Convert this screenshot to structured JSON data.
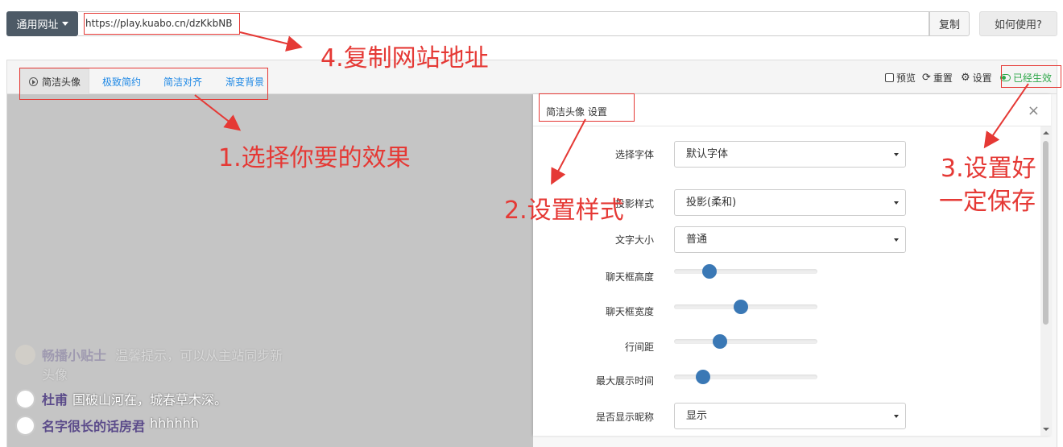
{
  "urlbar": {
    "dropdown_label": "通用网址",
    "url_value": "https://play.kuabo.cn/dzKkbNB",
    "copy_label": "复制",
    "help_label": "如何使用?"
  },
  "tabs": [
    {
      "label": "简洁头像"
    },
    {
      "label": "极致简约"
    },
    {
      "label": "简洁对齐"
    },
    {
      "label": "渐变背景"
    }
  ],
  "toolbar": {
    "preview_label": "预览",
    "reset_label": "重置",
    "settings_label": "设置",
    "status_label": "已经生效"
  },
  "chat": [
    {
      "nick": "畅播小贴士",
      "message": "温馨提示，可以从主站同步新",
      "message_cont": "头像"
    },
    {
      "nick": "杜甫",
      "message": "国破山河在，城春草木深。"
    },
    {
      "nick": "名字很长的话房君",
      "message": "hhhhhh"
    }
  ],
  "settings": {
    "title": "简洁头像 设置",
    "close": "×",
    "font_label": "选择字体",
    "font_value": "默认字体",
    "shadow_label": "投影样式",
    "shadow_value": "投影(柔和)",
    "size_label": "文字大小",
    "size_value": "普通",
    "height_label": "聊天框高度",
    "height_level": 0.22,
    "width_label": "聊天框宽度",
    "width_level": 0.46,
    "spacing_label": "行间距",
    "spacing_level": 0.3,
    "duration_label": "最大展示时间",
    "duration_level": 0.17,
    "nickname_label": "是否显示昵称",
    "nickname_value": "显示"
  },
  "annotations": {
    "step1": "1.选择你要的效果",
    "step2": "2.设置样式",
    "step3_line1": "3.设置好",
    "step3_line2": "一定保存",
    "step4": "4.复制网站地址"
  },
  "colors": {
    "accent_blue": "#1e88e5",
    "annotation_red": "#e53935",
    "success_green": "#2ea84a",
    "slider_knob": "#3a78b5",
    "dropdown_bg": "#4d5a66"
  },
  "icons": [
    "caret-down-icon",
    "play-circle-icon",
    "checkbox-icon",
    "refresh-icon",
    "gear-icon",
    "toggle-on-icon",
    "close-icon"
  ]
}
